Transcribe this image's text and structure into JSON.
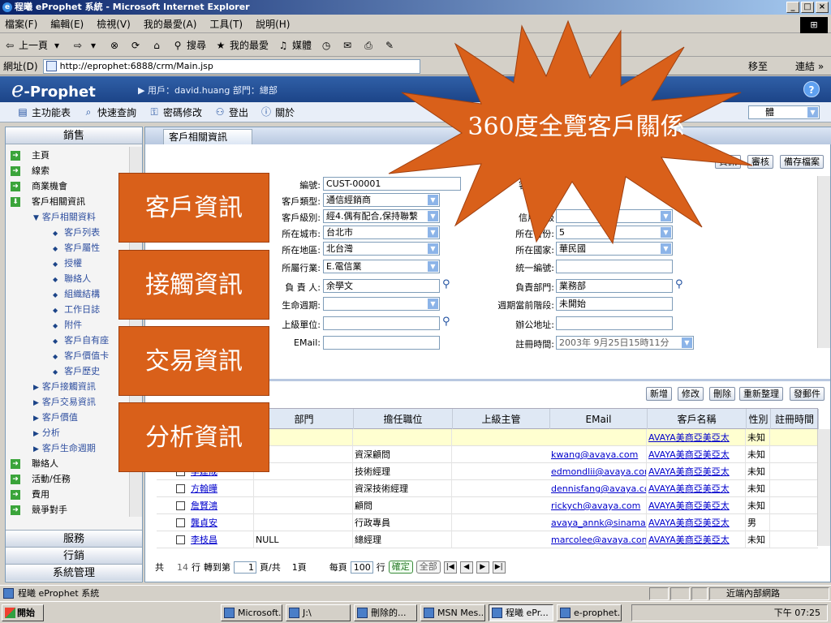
{
  "window": {
    "title": "程曦 eProphet 系統 - Microsoft Internet Explorer",
    "ie_glyph": "e",
    "min": "_",
    "max": "□",
    "close": "×"
  },
  "menu": [
    "檔案(F)",
    "編輯(E)",
    "檢視(V)",
    "我的最愛(A)",
    "工具(T)",
    "說明(H)"
  ],
  "winlogo": "⊞",
  "toolbar": {
    "back": "上一頁",
    "search": "搜尋",
    "favorites": "我的最愛",
    "media": "媒體"
  },
  "address": {
    "label": "網址(D)",
    "url": "http://eprophet:6888/crm/Main.jsp",
    "go": "移至",
    "links": "連結 »"
  },
  "app": {
    "logo_e": "e",
    "logo_rest": "-Prophet",
    "user_line": "用戶：david.huang 部門：總部",
    "help": "?"
  },
  "apptool": [
    "主功能表",
    "快速查詢",
    "密碼修改",
    "登出",
    "關於"
  ],
  "selector_value": "體",
  "sidebar": {
    "header": "銷售",
    "items": [
      "主頁",
      "線索",
      "商業機會",
      "客戶相關資訊"
    ],
    "sub_header": "客戶相關資料",
    "sub_items": [
      "客戶列表",
      "客戶屬性",
      "授權",
      "聯絡人",
      "組織結構",
      "工作日誌",
      "附件",
      "客戶自有座",
      "客戶價值卡",
      "客戶歷史"
    ],
    "groups": [
      "客戶接觸資訊",
      "客戶交易資訊",
      "客戶價值",
      "分析",
      "客戶生命週期"
    ],
    "items2": [
      "聯絡人",
      "活動/任務",
      "費用",
      "競爭對手"
    ],
    "footers": [
      "服務",
      "行銷",
      "系統管理"
    ]
  },
  "tab": "客戶相關資訊",
  "form_buttons": [
    "資訊",
    "審核",
    "備存檔案"
  ],
  "form": {
    "id_label": "編號:",
    "id_value": "CUST-00001",
    "type_label": "客戶類型:",
    "type_value": "通信經銷商",
    "level_label": "客戶級別:",
    "level_value": "經4.偶有配合,保持聯繫",
    "city_label": "所在城市:",
    "city_value": "台北市",
    "area_label": "所在地區:",
    "area_value": "北台灣",
    "industry_label": "所屬行業:",
    "industry_value": "E.電信業",
    "owner_label": "負 責 人:",
    "owner_value": "余學文",
    "lifecycle_label": "生命週期:",
    "lifecycle_value": "",
    "parent_label": "上級單位:",
    "parent_value": "",
    "email_label": "EMail:",
    "email_value": "",
    "status_label": "客戶狀態",
    "status_extra": "份",
    "credit_label": "信用等級",
    "province_label": "所在省份:",
    "province_value": "5",
    "country_label": "所在國家:",
    "country_value": "華民國",
    "taxid_label": "統一編號:",
    "taxid_value": "",
    "dept_label": "負責部門:",
    "dept_value": "業務部",
    "stage_label": "週期當前階段:",
    "stage_value": "未開始",
    "office_label": "辦公地址:",
    "office_value": "",
    "reg_label": "註冊時間:",
    "reg_value": "2003年 9月25日15時11分"
  },
  "grid_buttons": [
    "新增",
    "修改",
    "刪除",
    "重新整理",
    "發郵件"
  ],
  "grid": {
    "columns": [
      "部門",
      "擔任職位",
      "上級主管",
      "EMail",
      "客戶名稱",
      "性別",
      "註冊時間"
    ],
    "rows": [
      {
        "name": "",
        "dept": "",
        "title": "",
        "email": "",
        "customer": "AVAYA美商亞美亞太",
        "gender": "未知"
      },
      {
        "name": "",
        "dept": "",
        "title": "資深顧問",
        "email": "kwang@avaya.com",
        "customer": "AVAYA美商亞美亞太",
        "gender": "未知"
      },
      {
        "name": "李建成",
        "dept": "",
        "title": "技術經理",
        "email": "edmondlii@avaya.com",
        "customer": "AVAYA美商亞美亞太",
        "gender": "未知"
      },
      {
        "name": "方翰曄",
        "dept": "",
        "title": "資深技術經理",
        "email": "dennisfang@avaya.com",
        "customer": "AVAYA美商亞美亞太",
        "gender": "未知"
      },
      {
        "name": "詹賢鴻",
        "dept": "",
        "title": "顧問",
        "email": "rickych@avaya.com",
        "customer": "AVAYA美商亞美亞太",
        "gender": "未知"
      },
      {
        "name": "龔貞安",
        "dept": "",
        "title": "行政專員",
        "email": "avaya_annk@sinamail.com",
        "customer": "AVAYA美商亞美亞太",
        "gender": "男"
      },
      {
        "name": "李枝昌",
        "dept": "NULL",
        "title": "總經理",
        "email": "marcolee@avaya.com",
        "customer": "AVAYA美商亞美亞太",
        "gender": "未知"
      }
    ]
  },
  "pager": {
    "total_prefix": "共",
    "total": "14",
    "rows_unit": "行",
    "goto": "轉到第",
    "page": "1",
    "page_of": "頁/共",
    "pages": "1頁",
    "per_page": "每頁",
    "per_page_value": "100",
    "ok": "確定",
    "all": "全部"
  },
  "status": {
    "text": "程曦 eProphet 系統",
    "zone": "近端內部網路"
  },
  "taskbar": {
    "start": "開始",
    "tasks": [
      "Microsoft...",
      "J:\\",
      "刪除的...",
      "MSN Mes...",
      "程曦 ePr...",
      "e-prophet..."
    ],
    "clock": "下午 07:25"
  },
  "overlays": {
    "customer": "客戶資訊",
    "contact": "接觸資訊",
    "transaction": "交易資訊",
    "analysis": "分析資訊",
    "starburst": "360度全覽客戶關係"
  },
  "colors": {
    "overlay": "#d9601a",
    "app_header": "#1c4488",
    "link": "#0000cc"
  }
}
